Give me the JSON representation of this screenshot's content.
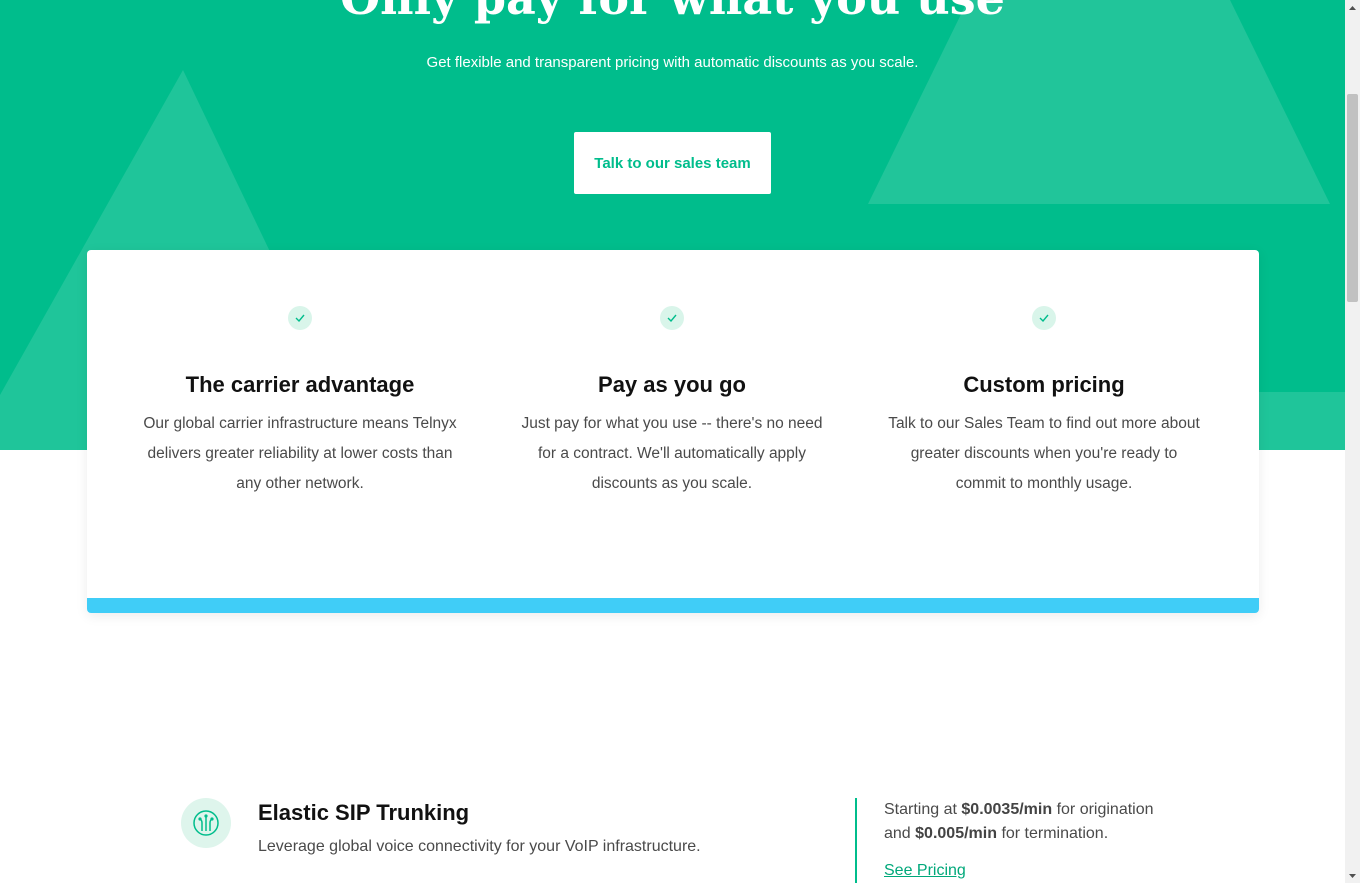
{
  "hero": {
    "title": "Only pay for what you use",
    "subtitle": "Get flexible and transparent pricing with automatic discounts as you scale.",
    "cta_label": "Talk to our sales team"
  },
  "features": [
    {
      "icon": "check-icon",
      "title": "The carrier advantage",
      "text": "Our global carrier infrastructure means Telnyx delivers greater reliability at lower costs than any other network."
    },
    {
      "icon": "check-icon",
      "title": "Pay as you go",
      "text": "Just pay for what you use -- there's no need for a contract. We'll automatically apply discounts as you scale."
    },
    {
      "icon": "check-icon",
      "title": "Custom pricing",
      "text": "Talk to our Sales Team to find out more about greater discounts when you're ready to commit to monthly usage."
    }
  ],
  "product": {
    "icon": "sip-trunking-icon",
    "title": "Elastic SIP Trunking",
    "description": "Leverage global voice connectivity for your VoIP infrastructure.",
    "price_prefix": "Starting at",
    "origination_price": "$0.0035/min",
    "origination_suffix": "for origination",
    "price_and": "and",
    "termination_price": "$0.005/min",
    "termination_suffix": "for termination.",
    "link_label": "See Pricing"
  },
  "colors": {
    "brand_green": "#00bd8c",
    "card_accent_blue": "#40cdf7",
    "check_bg": "#d9f5ea"
  }
}
